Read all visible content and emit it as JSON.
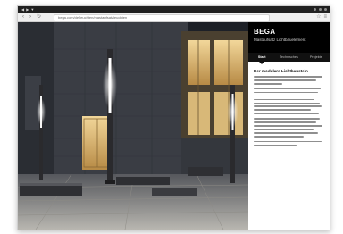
{
  "browser": {
    "tab_label": "◀ ▶ ▼",
    "nav_back": "‹",
    "nav_forward": "›",
    "nav_reload": "↻",
    "url": "bega.com/de/leuchten/mastaufsatzleuchten",
    "tool_icons": [
      "star-icon",
      "menu-icon"
    ],
    "tool_glyphs": [
      "☆",
      "≡"
    ]
  },
  "panel": {
    "brand": "BEGA",
    "subtitle": "Mastaufsatz Lichtbauelement",
    "tabs": [
      {
        "label": "Start",
        "active": true
      },
      {
        "label": "Technisches",
        "active": false
      },
      {
        "label": "Projekte",
        "active": false
      }
    ],
    "heading": "Der modulare Lichtbaustein"
  },
  "colors": {
    "panel_head": "#000000",
    "warm_light": "#e8c880",
    "facade": "#3a3d44"
  }
}
